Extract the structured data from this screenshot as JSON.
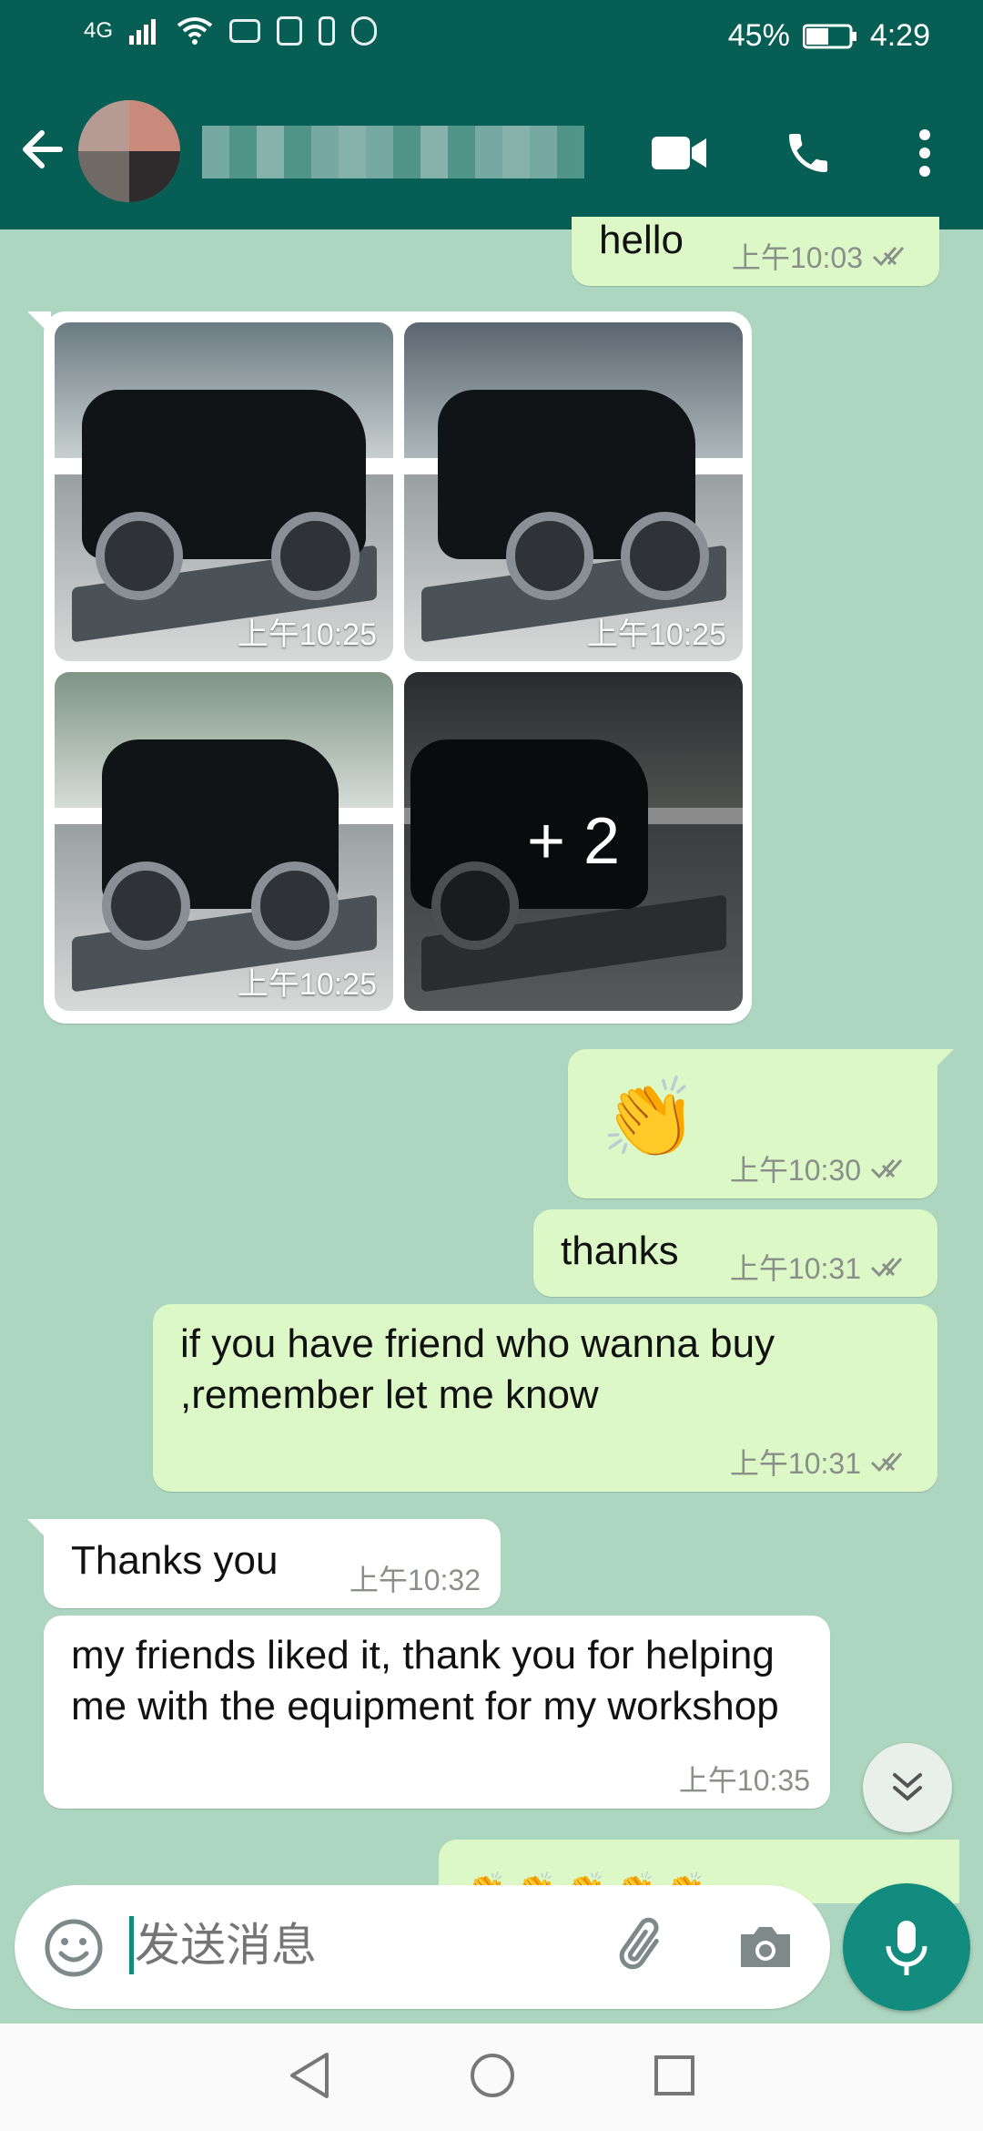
{
  "status": {
    "network": "4G",
    "battery": "45%",
    "time": "4:29"
  },
  "header": {
    "icons": [
      "back-arrow-icon",
      "video-call-icon",
      "phone-icon",
      "more-vert-icon"
    ]
  },
  "messages": [
    {
      "dir": "out",
      "text": "hello",
      "time": "上午10:03",
      "status": "read"
    },
    {
      "dir": "in",
      "type": "media_grid",
      "items": [
        {
          "time": "上午10:25"
        },
        {
          "time": "上午10:25"
        },
        {
          "time": "上午10:25"
        },
        {
          "more": "+ 2"
        }
      ]
    },
    {
      "dir": "out",
      "text": "👏",
      "time": "上午10:30",
      "status": "read"
    },
    {
      "dir": "out",
      "text": "thanks",
      "time": "上午10:31",
      "status": "read"
    },
    {
      "dir": "out",
      "text": "if you have friend who wanna buy ,remember let me know",
      "time": "上午10:31",
      "status": "read"
    },
    {
      "dir": "in",
      "text": "Thanks you",
      "time": "上午10:32"
    },
    {
      "dir": "in",
      "text": "my friends liked it, thank you for helping me with the equipment for my workshop",
      "time": "上午10:35"
    },
    {
      "dir": "out",
      "text": "👏👏👏👏👏",
      "partial": true
    }
  ],
  "composer": {
    "placeholder": "发送消息",
    "icons": [
      "emoji-icon",
      "attach-icon",
      "camera-icon",
      "mic-icon"
    ]
  },
  "scroll": {
    "icon": "double-chevron-down-icon"
  },
  "navbar": {
    "icons": [
      "back-triangle-icon",
      "home-circle-icon",
      "recent-square-icon"
    ]
  },
  "colors": {
    "primary": "#075e54",
    "accent": "#128c7e",
    "outgoing": "#dcf8c6",
    "incoming": "#ffffff",
    "wallpaper": "#acd6bf"
  }
}
